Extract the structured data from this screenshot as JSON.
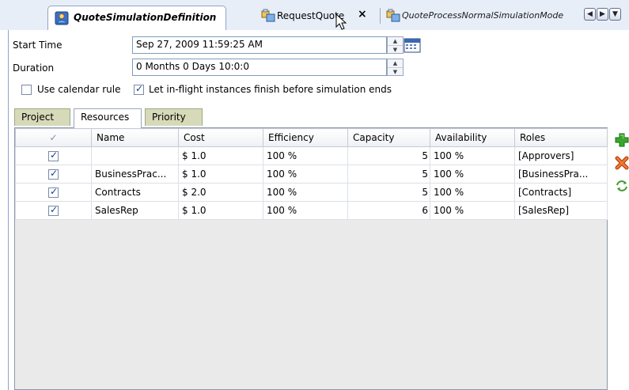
{
  "tabs": {
    "active": {
      "label": "QuoteSimulationDefinition",
      "icon": "simulation-definition-icon"
    },
    "second": {
      "label": "RequestQuote",
      "icon": "process-icon",
      "close_label": "×"
    },
    "third": {
      "label": "QuoteProcessNormalSimulationMode",
      "icon": "process-icon"
    },
    "nav": {
      "left": "◀",
      "right": "▶",
      "list": "▼"
    }
  },
  "form": {
    "start_time_label": "Start Time",
    "start_time_value": "Sep 27, 2009 11:59:25 AM",
    "duration_label": "Duration",
    "duration_value": "0 Months 0 Days 10:0:0",
    "use_calendar_rule_label": "Use calendar rule",
    "use_calendar_rule_checked": false,
    "inflight_label": "Let in-flight instances finish before simulation ends",
    "inflight_checked": true
  },
  "subtabs": [
    {
      "label": "Project",
      "active": false
    },
    {
      "label": "Resources",
      "active": true
    },
    {
      "label": "Priority",
      "active": false
    }
  ],
  "table": {
    "columns": [
      "✓",
      "Name",
      "Cost",
      "Efficiency",
      "Capacity",
      "Availability",
      "Roles"
    ],
    "rows": [
      {
        "enabled": true,
        "name": "",
        "cost": "$ 1.0",
        "efficiency": "100 %",
        "capacity": "5",
        "availability": "100 %",
        "roles": "[Approvers]"
      },
      {
        "enabled": true,
        "name": "BusinessPrac...",
        "cost": "$ 1.0",
        "efficiency": "100 %",
        "capacity": "5",
        "availability": "100 %",
        "roles": "[BusinessPra..."
      },
      {
        "enabled": true,
        "name": "Contracts",
        "cost": "$ 2.0",
        "efficiency": "100 %",
        "capacity": "5",
        "availability": "100 %",
        "roles": "[Contracts]"
      },
      {
        "enabled": true,
        "name": "SalesRep",
        "cost": "$ 1.0",
        "efficiency": "100 %",
        "capacity": "6",
        "availability": "100 %",
        "roles": "[SalesRep]"
      }
    ]
  },
  "side_buttons": [
    {
      "icon": "add-icon",
      "color": "#2e9d22"
    },
    {
      "icon": "remove-icon",
      "color": "#d6501c"
    },
    {
      "icon": "refresh-icon",
      "color": "#3f9a30"
    }
  ],
  "colors": {
    "tab_strip": "#e8eef8",
    "subtab_inactive": "#d6dab8",
    "table_empty_area": "#eaeaea",
    "checkmark": "#1a3d8f"
  }
}
